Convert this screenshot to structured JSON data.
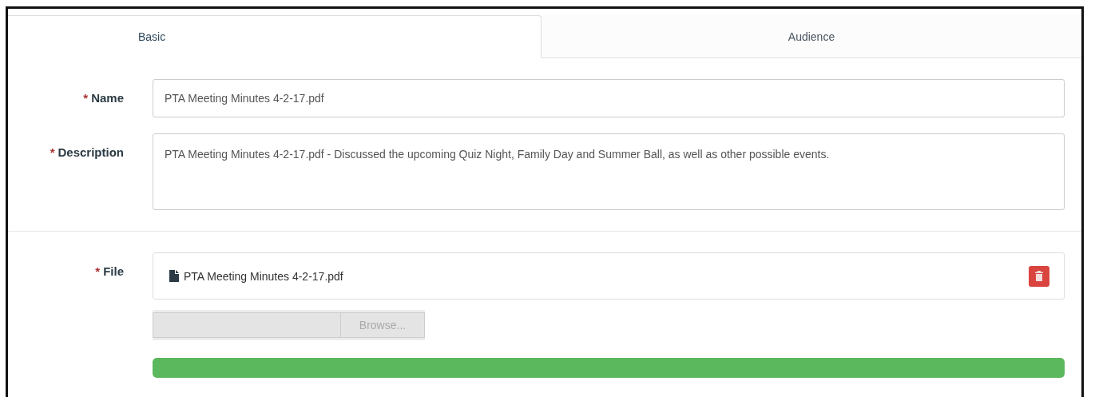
{
  "tabs": [
    {
      "label": "Basic",
      "selected": true
    },
    {
      "label": "Audience",
      "selected": false
    }
  ],
  "fields": [
    {
      "label": "Name",
      "required": true,
      "kind": "input",
      "value": "PTA Meeting Minutes 4-2-17.pdf"
    },
    {
      "label": "Description",
      "required": true,
      "kind": "textarea",
      "value": "PTA Meeting Minutes 4-2-17.pdf - Discussed the upcoming Quiz Night, Family Day and Summer Ball, as well as other possible events."
    }
  ],
  "file": {
    "label": "File",
    "required": true,
    "name": "PTA Meeting Minutes 4-2-17.pdf",
    "browse": "Browse...",
    "level": 1
  },
  "required_mark": "*"
}
